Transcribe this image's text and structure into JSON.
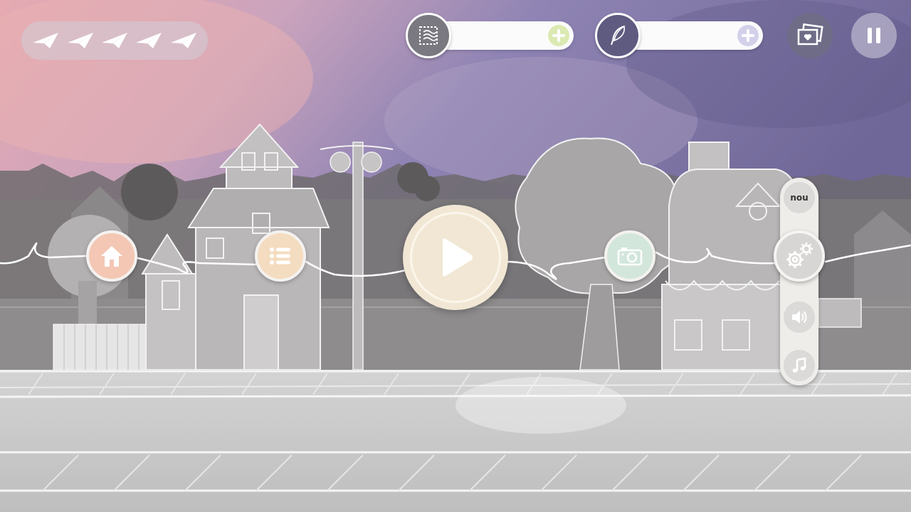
{
  "hud": {
    "lives": {
      "count": 5,
      "icon": "paper-plane-icon"
    },
    "stamps": {
      "icon": "stamp-icon",
      "value": "",
      "plus_color": "#dbeab2"
    },
    "quills": {
      "icon": "quill-icon",
      "value": "",
      "plus_color": "#d3d0ea"
    },
    "album_icon": "photo-album-icon",
    "pause_icon": "pause-icon"
  },
  "path_buttons": {
    "home": {
      "icon": "home-icon",
      "color": "#f3c7b4"
    },
    "levels": {
      "icon": "list-icon",
      "color": "#f4dcc0"
    },
    "play": {
      "icon": "play-icon",
      "color": "#f1e7d4"
    },
    "camera": {
      "icon": "camera-icon",
      "color": "#d3e6dc"
    }
  },
  "settings_panel": {
    "new_label": "nou",
    "settings_icon": "gear-icon",
    "sound_icon": "speaker-icon",
    "music_icon": "music-note-icon"
  }
}
